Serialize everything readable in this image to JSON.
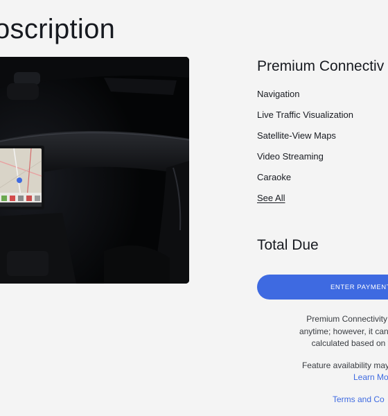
{
  "page": {
    "title": "oscription"
  },
  "plan": {
    "title": "Premium Connectiv",
    "features": [
      "Navigation",
      "Live Traffic Visualization",
      "Satellite-View Maps",
      "Video Streaming",
      "Caraoke"
    ],
    "see_all_label": "See All"
  },
  "checkout": {
    "total_due_label": "Total Due",
    "payment_button_label": "ENTER PAYMENT",
    "disclaimer_1_lines": [
      "Premium Connectivity subscr",
      "anytime; however, it cannot be re",
      "calculated based on your r"
    ],
    "disclaimer_2_line": "Feature availability may vary by",
    "learn_more_label": "Learn Mo",
    "terms_label": "Terms and Co"
  },
  "colors": {
    "background": "#f4f4f4",
    "accent": "#3e6ae1",
    "text": "#171a20"
  },
  "icons": {
    "hero_image": "car-interior-dashboard-image"
  }
}
